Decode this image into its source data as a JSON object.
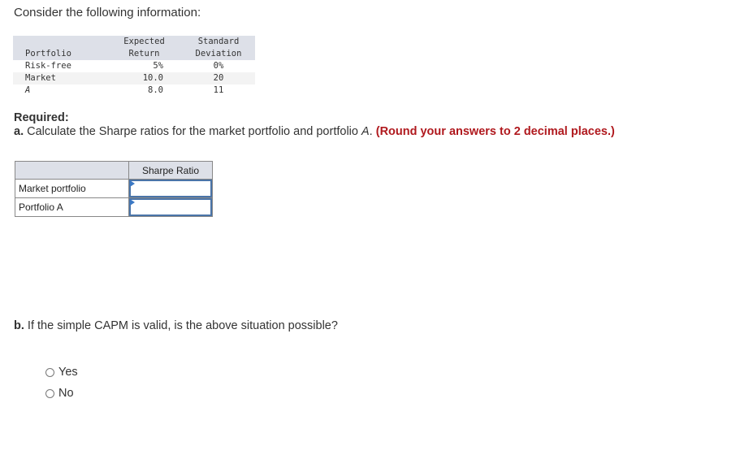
{
  "intro": "Consider the following information:",
  "info_table": {
    "headers": {
      "portfolio": "Portfolio",
      "expected_return_line1": "Expected",
      "expected_return_line2": "Return",
      "std_dev_line1": "Standard",
      "std_dev_line2": "Deviation"
    },
    "rows": [
      {
        "portfolio": "Risk-free",
        "expected_return": "5%",
        "std_dev": "0%"
      },
      {
        "portfolio": "Market",
        "expected_return": "10.0",
        "std_dev": "20"
      },
      {
        "portfolio": "A",
        "expected_return": "8.0",
        "std_dev": "11"
      }
    ]
  },
  "required": {
    "label": "Required:",
    "part_a_prefix": "a.",
    "part_a_text": " Calculate the Sharpe ratios for the market portfolio and portfolio ",
    "part_a_italic": "A",
    "part_a_period": ".",
    "part_a_instruction": "(Round your answers to 2 decimal places.)"
  },
  "answer_table": {
    "header": "Sharpe Ratio",
    "rows": [
      {
        "label": "Market portfolio",
        "value": ""
      },
      {
        "label": "Portfolio A",
        "value": ""
      }
    ]
  },
  "part_b": {
    "prefix": "b.",
    "text": " If the simple CAPM is valid, is the above situation possible?"
  },
  "radio_options": [
    {
      "label": "Yes",
      "selected": false
    },
    {
      "label": "No",
      "selected": false
    }
  ],
  "colors": {
    "instruction_red": "#b0191e",
    "header_bg": "#dde0e8",
    "input_border": "#4a74a8",
    "flag_blue": "#3b78c4"
  }
}
